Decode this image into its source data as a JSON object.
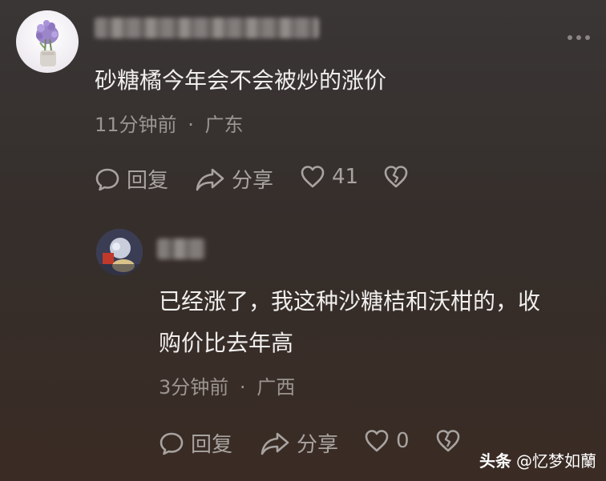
{
  "comment": {
    "text": "砂糖橘今年会不会被炒的涨价",
    "time": "11分钟前",
    "location": "广东",
    "actions": {
      "reply_label": "回复",
      "share_label": "分享",
      "like_count": "41"
    }
  },
  "reply": {
    "text_line1": "已经涨了，我这种沙糖桔和沃柑的，收",
    "text_line2": "购价比去年高",
    "time": "3分钟前",
    "location": "广西",
    "actions": {
      "reply_label": "回复",
      "share_label": "分享",
      "like_count": "0"
    }
  },
  "separator": "·",
  "watermark": {
    "brand": "头条",
    "author": "@忆梦如蘭"
  },
  "icons": [
    "avatar",
    "more-icon",
    "comment-bubble-icon",
    "share-icon",
    "heart-icon",
    "broken-heart-icon"
  ]
}
